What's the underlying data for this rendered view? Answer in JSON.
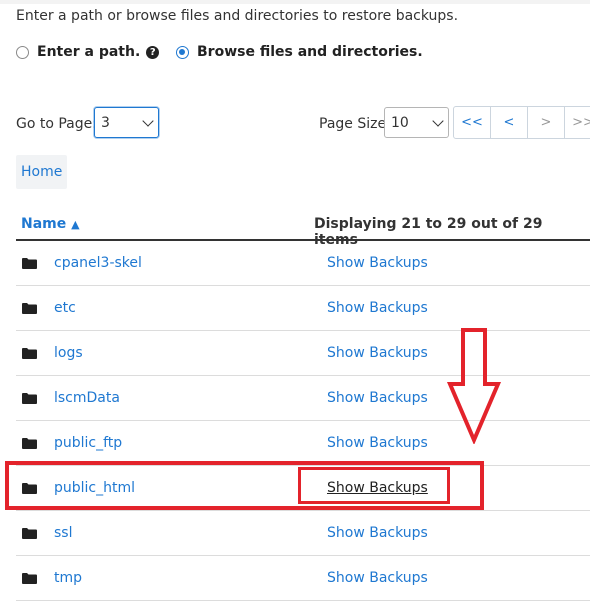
{
  "intro_text": "Enter a path or browse files and directories to restore backups.",
  "mode": {
    "option_path": "Enter a path.",
    "option_browse": "Browse files and directories."
  },
  "paging": {
    "goto_label": "Go to Page:",
    "page_value": "3",
    "page_size_label": "Page Size",
    "page_size_value": "10",
    "buttons": [
      "<<",
      "<",
      ">",
      ">>"
    ]
  },
  "breadcrumb": {
    "home": "Home"
  },
  "table": {
    "col_name": "Name",
    "sort_indicator": "▲",
    "display_summary": "Displaying 21 to 29 out of 29 items",
    "rows": [
      {
        "name": "cpanel3-skel",
        "action": "Show Backups"
      },
      {
        "name": "etc",
        "action": "Show Backups"
      },
      {
        "name": "logs",
        "action": "Show Backups"
      },
      {
        "name": "lscmData",
        "action": "Show Backups"
      },
      {
        "name": "public_ftp",
        "action": "Show Backups"
      },
      {
        "name": "public_html",
        "action": "Show Backups"
      },
      {
        "name": "ssl",
        "action": "Show Backups"
      },
      {
        "name": "tmp",
        "action": "Show Backups"
      }
    ]
  },
  "colors": {
    "accent": "#1f78d1",
    "annotation": "#e3232b"
  },
  "icons": {
    "help": "question-circle-icon",
    "folder": "folder-icon",
    "annotation_arrow": "down-arrow-annotation"
  }
}
